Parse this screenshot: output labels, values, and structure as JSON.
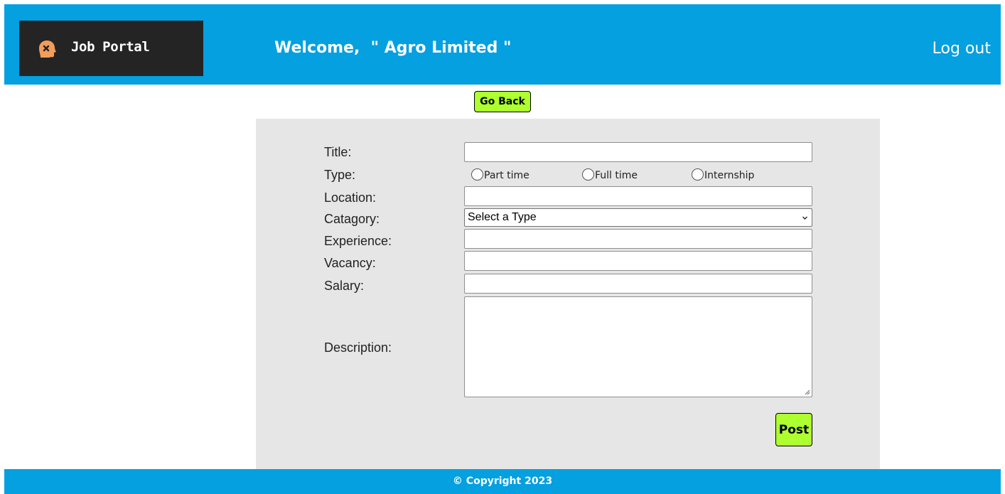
{
  "header": {
    "logo_text": "Job Portal",
    "logo_icon": "brain-head-icon",
    "welcome_text": "Welcome,  \" Agro Limited \"",
    "logout_label": "Log out",
    "color": "#04a0e0"
  },
  "go_back_label": "Go Back",
  "form": {
    "title_label": "Title:",
    "type_label": "Type:",
    "type_options": [
      "Part time",
      "Full time",
      "Internship"
    ],
    "location_label": "Location:",
    "category_label": "Catagory:",
    "category_selected": "Select a Type",
    "experience_label": "Experience:",
    "vacancy_label": "Vacancy:",
    "salary_label": "Salary:",
    "description_label": "Description:",
    "post_label": "Post",
    "button_color": "#adff2f"
  },
  "footer": {
    "copyright": "© Copyright 2023"
  }
}
